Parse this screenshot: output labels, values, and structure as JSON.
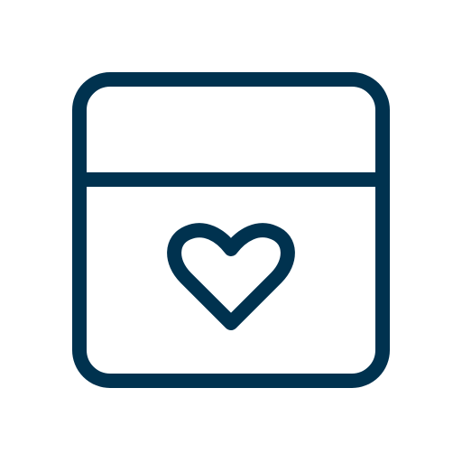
{
  "icon": {
    "name": "calendar-heart-icon",
    "stroke_color": "#00324f",
    "background_color": "#ffffff"
  }
}
